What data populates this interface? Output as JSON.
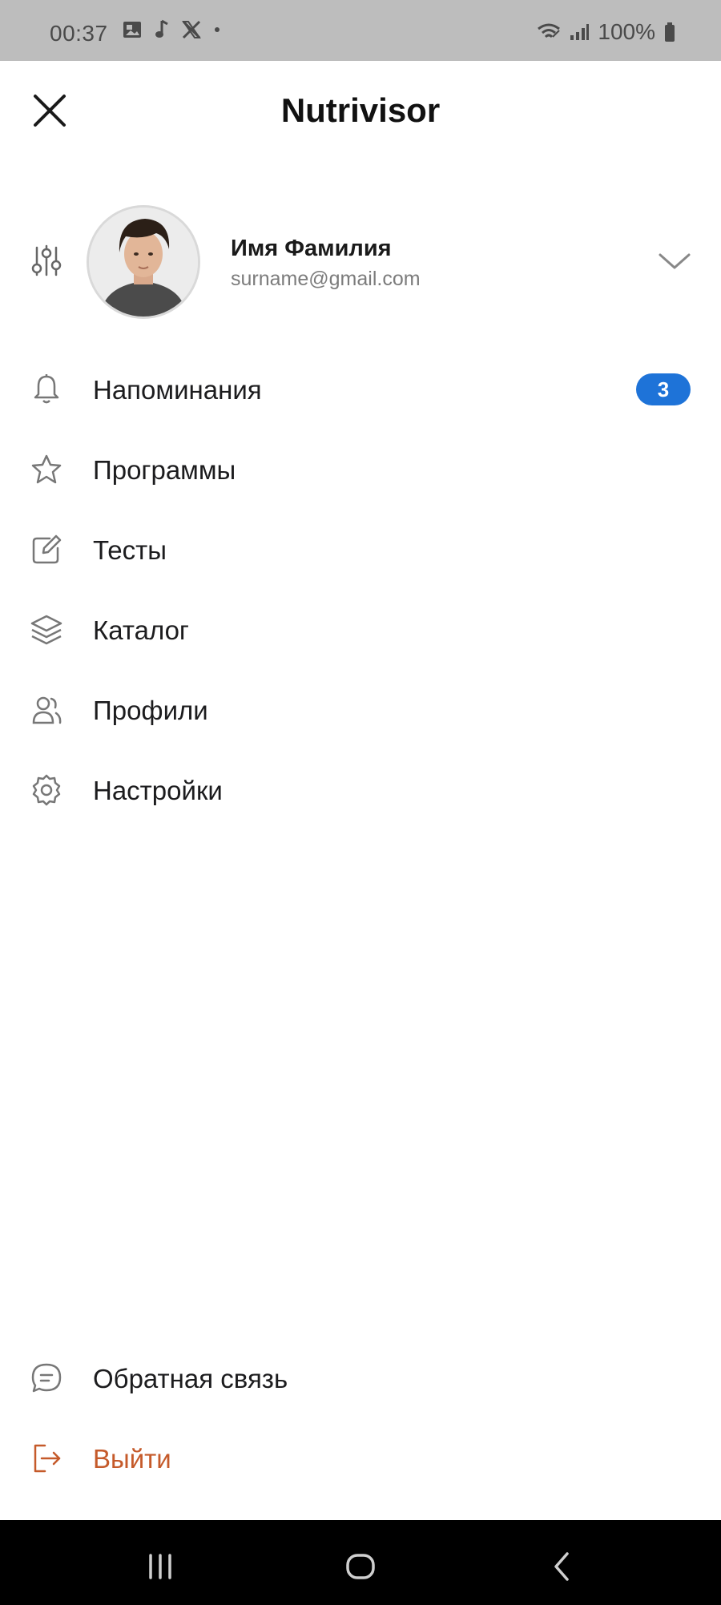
{
  "status_bar": {
    "time": "00:37",
    "left_icons": [
      "gallery-icon",
      "music-note-icon",
      "x-logo-icon",
      "dot-icon"
    ],
    "right_icons": [
      "wifi-icon",
      "signal-icon"
    ],
    "battery": "100%"
  },
  "header": {
    "title": "Nutrivisor",
    "close_icon": "close-icon"
  },
  "profile": {
    "name": "Имя Фамилия",
    "email": "surname@gmail.com"
  },
  "menu": {
    "items": [
      {
        "label": "Напоминания",
        "icon": "bell-icon",
        "badge": "3"
      },
      {
        "label": "Программы",
        "icon": "star-icon"
      },
      {
        "label": "Тесты",
        "icon": "edit-icon"
      },
      {
        "label": "Каталог",
        "icon": "layers-icon"
      },
      {
        "label": "Профили",
        "icon": "users-icon"
      },
      {
        "label": "Настройки",
        "icon": "gear-icon"
      }
    ]
  },
  "bottom_menu": {
    "feedback_label": "Обратная связь",
    "logout_label": "Выйти"
  },
  "colors": {
    "badge": "#1e73d8",
    "logout": "#c55a2a",
    "status_bar_bg": "#bdbdbd",
    "nav_bar_bg": "#000000"
  }
}
